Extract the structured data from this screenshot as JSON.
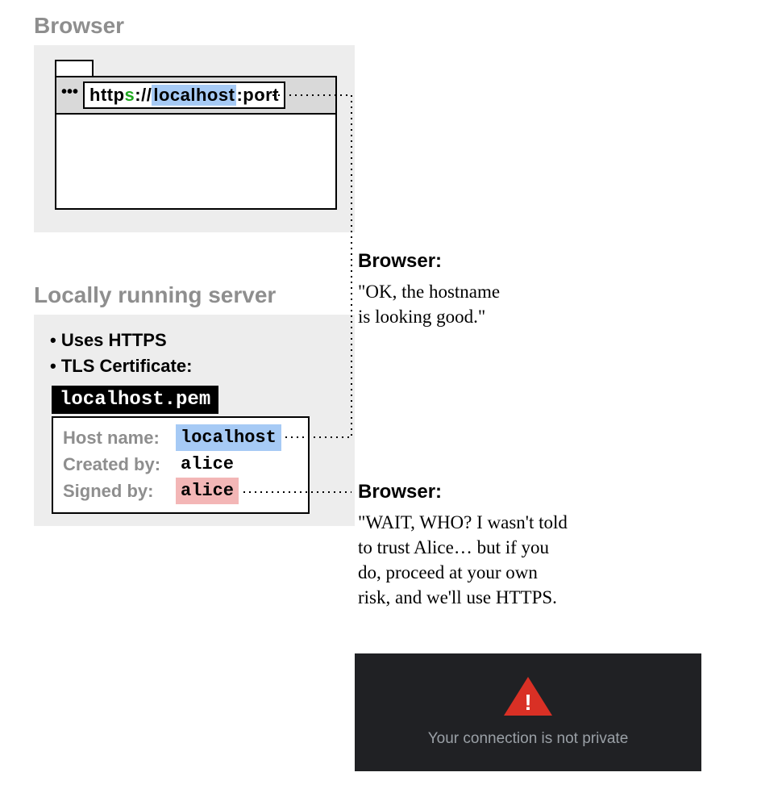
{
  "sections": {
    "browser_title": "Browser",
    "server_title": "Locally running server"
  },
  "url": {
    "prefix_http": "http",
    "s": "s",
    "sep": "://",
    "host": "localhost",
    "suffix": ":port",
    "dots": "•••"
  },
  "server": {
    "line1": "Uses HTTPS",
    "line2": "TLS Certificate:",
    "cert_file": "localhost.pem",
    "rows": {
      "hostname_key": "Host name:",
      "hostname_val": "localhost",
      "createdby_key": "Created by:",
      "createdby_val": "alice",
      "signedby_key": "Signed by:",
      "signedby_val": "alice"
    }
  },
  "annotations": {
    "label": "Browser:",
    "ok_line1": "\"OK, the hostname",
    "ok_line2": "is looking good.\"",
    "warn_line1": "\"WAIT, WHO? I wasn't told",
    "warn_line2": "to trust Alice… but if you",
    "warn_line3": "do, proceed at your own",
    "warn_line4": "risk, and we'll use HTTPS."
  },
  "warning": {
    "bang": "!",
    "msg": "Your connection is not private"
  }
}
